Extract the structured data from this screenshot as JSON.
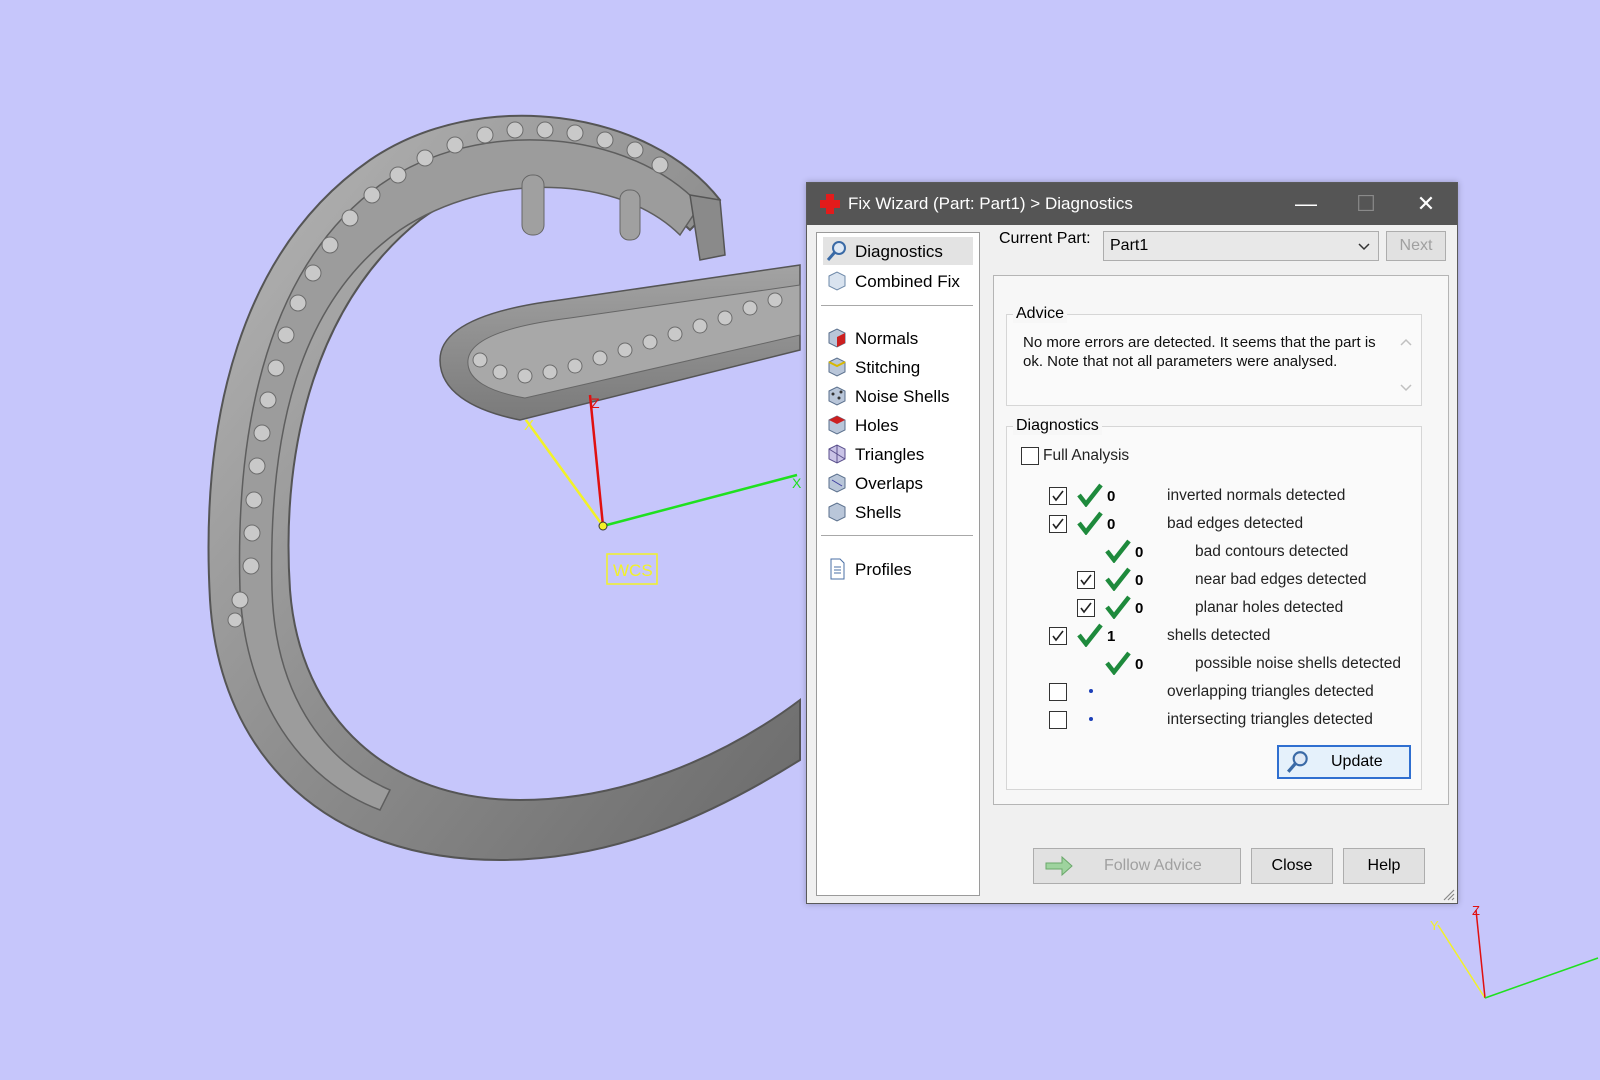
{
  "viewport": {
    "wcs_label": "WCS",
    "axes": {
      "x": "X",
      "y": "X",
      "z": "Z"
    },
    "mini_axes": {
      "y": "Y",
      "z": "Z"
    }
  },
  "dialog": {
    "title": "Fix Wizard (Part: Part1) > Diagnostics",
    "nav": {
      "items_top": [
        {
          "label": "Diagnostics",
          "icon": "magnifier-icon",
          "active": true
        },
        {
          "label": "Combined Fix",
          "icon": "cube-icon",
          "active": false
        }
      ],
      "items_mid": [
        {
          "label": "Normals",
          "icon": "normals-cube-icon"
        },
        {
          "label": "Stitching",
          "icon": "stitching-cube-icon"
        },
        {
          "label": "Noise Shells",
          "icon": "noise-shells-icon"
        },
        {
          "label": "Holes",
          "icon": "holes-cube-icon"
        },
        {
          "label": "Triangles",
          "icon": "triangles-cube-icon"
        },
        {
          "label": "Overlaps",
          "icon": "overlaps-cube-icon"
        },
        {
          "label": "Shells",
          "icon": "shells-cube-icon"
        }
      ],
      "items_bottom": [
        {
          "label": "Profiles",
          "icon": "document-icon"
        }
      ]
    },
    "current_part_label": "Current Part:",
    "current_part_value": "Part1",
    "next_label": "Next",
    "advice": {
      "title": "Advice",
      "text": "No more errors are detected. It seems that the part is ok. Note that not all parameters were analysed."
    },
    "diagnostics": {
      "title": "Diagnostics",
      "full_analysis_label": "Full Analysis",
      "full_analysis_checked": false,
      "rows": [
        {
          "label": "inverted normals detected",
          "count": "0",
          "checked": true,
          "ok": true,
          "indent": 0
        },
        {
          "label": "bad edges detected",
          "count": "0",
          "checked": true,
          "ok": true,
          "indent": 0
        },
        {
          "label": "bad contours detected",
          "count": "0",
          "checked": null,
          "ok": true,
          "indent": 1
        },
        {
          "label": "near bad edges detected",
          "count": "0",
          "checked": true,
          "ok": true,
          "indent": 1
        },
        {
          "label": "planar holes detected",
          "count": "0",
          "checked": true,
          "ok": true,
          "indent": 1
        },
        {
          "label": "shells detected",
          "count": "1",
          "checked": true,
          "ok": true,
          "indent": 0
        },
        {
          "label": "possible noise shells detected",
          "count": "0",
          "checked": null,
          "ok": true,
          "indent": 1
        },
        {
          "label": "overlapping triangles detected",
          "count": "",
          "checked": false,
          "ok": false,
          "indent": 0
        },
        {
          "label": "intersecting triangles detected",
          "count": "",
          "checked": false,
          "ok": false,
          "indent": 0
        }
      ],
      "update_label": "Update"
    },
    "footer": {
      "follow_advice_label": "Follow Advice",
      "close_label": "Close",
      "help_label": "Help"
    }
  }
}
